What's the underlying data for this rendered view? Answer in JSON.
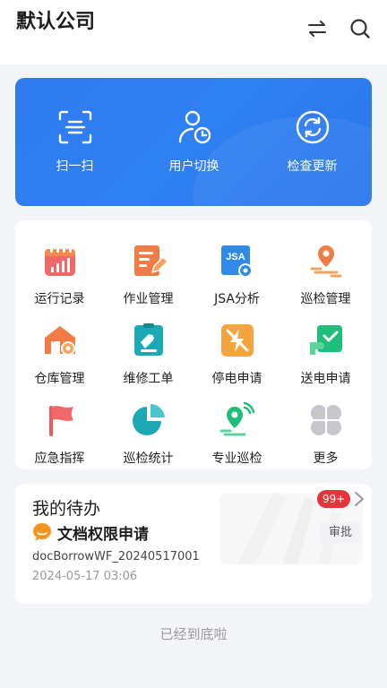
{
  "header": {
    "company_name": "默认公司",
    "switch_icon": "swap-arrows-icon",
    "search_icon": "search-icon"
  },
  "quick_actions": [
    {
      "label": "扫一扫",
      "icon": "scan-icon"
    },
    {
      "label": "用户切换",
      "icon": "user-switch-icon"
    },
    {
      "label": "检查更新",
      "icon": "refresh-icon"
    }
  ],
  "grid": [
    {
      "label": "运行记录",
      "icon": "calendar-chart-icon"
    },
    {
      "label": "作业管理",
      "icon": "document-edit-icon"
    },
    {
      "label": "JSA分析",
      "icon": "jsa-settings-icon",
      "icon_text": "JSA"
    },
    {
      "label": "巡检管理",
      "icon": "route-pin-icon"
    },
    {
      "label": "仓库管理",
      "icon": "warehouse-icon"
    },
    {
      "label": "维修工单",
      "icon": "wrench-clipboard-icon"
    },
    {
      "label": "停电申请",
      "icon": "power-off-icon"
    },
    {
      "label": "送电申请",
      "icon": "hand-check-icon"
    },
    {
      "label": "应急指挥",
      "icon": "flag-icon"
    },
    {
      "label": "巡检统计",
      "icon": "pie-chart-icon"
    },
    {
      "label": "专业巡检",
      "icon": "location-wifi-icon"
    },
    {
      "label": "更多",
      "icon": "more-grid-icon"
    }
  ],
  "todo": {
    "title": "我的待办",
    "badge": "99+",
    "item": {
      "title": "文档权限申请",
      "action": "审批",
      "id": "docBorrowWF_20240517001",
      "time": "2024-05-17 03:06"
    }
  },
  "footer": "已经到底啦",
  "colors": {
    "accent_blue": "#2f7ff1",
    "badge_red": "#e5343b",
    "icon_orange": "#f27a44",
    "icon_teal": "#1aa9b5",
    "icon_green": "#1fbf7a"
  }
}
